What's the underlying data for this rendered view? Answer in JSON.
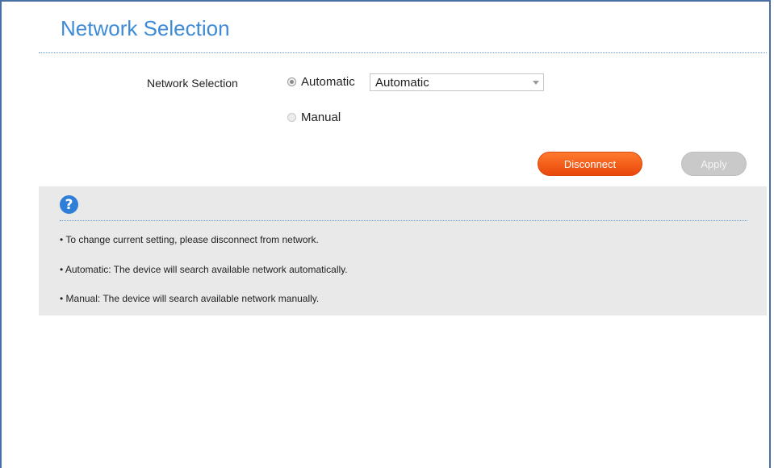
{
  "page": {
    "title": "Network Selection"
  },
  "form": {
    "field_label": "Network Selection",
    "options": [
      {
        "label": "Automatic",
        "checked": true
      },
      {
        "label": "Manual",
        "checked": false
      }
    ],
    "select": {
      "selected": "Automatic"
    }
  },
  "buttons": {
    "disconnect": "Disconnect",
    "apply": "Apply"
  },
  "help": {
    "icon": "question-icon",
    "lines": [
      "• To change current setting, please disconnect from network.",
      "• Automatic: The device will search available network automatically.",
      "• Manual: The device will search available network manually."
    ]
  },
  "colors": {
    "title": "#3d8ad6",
    "disconnect_button": "#f05a16",
    "apply_button_disabled": "#c9c9c9",
    "help_panel": "#e9e9e9"
  }
}
